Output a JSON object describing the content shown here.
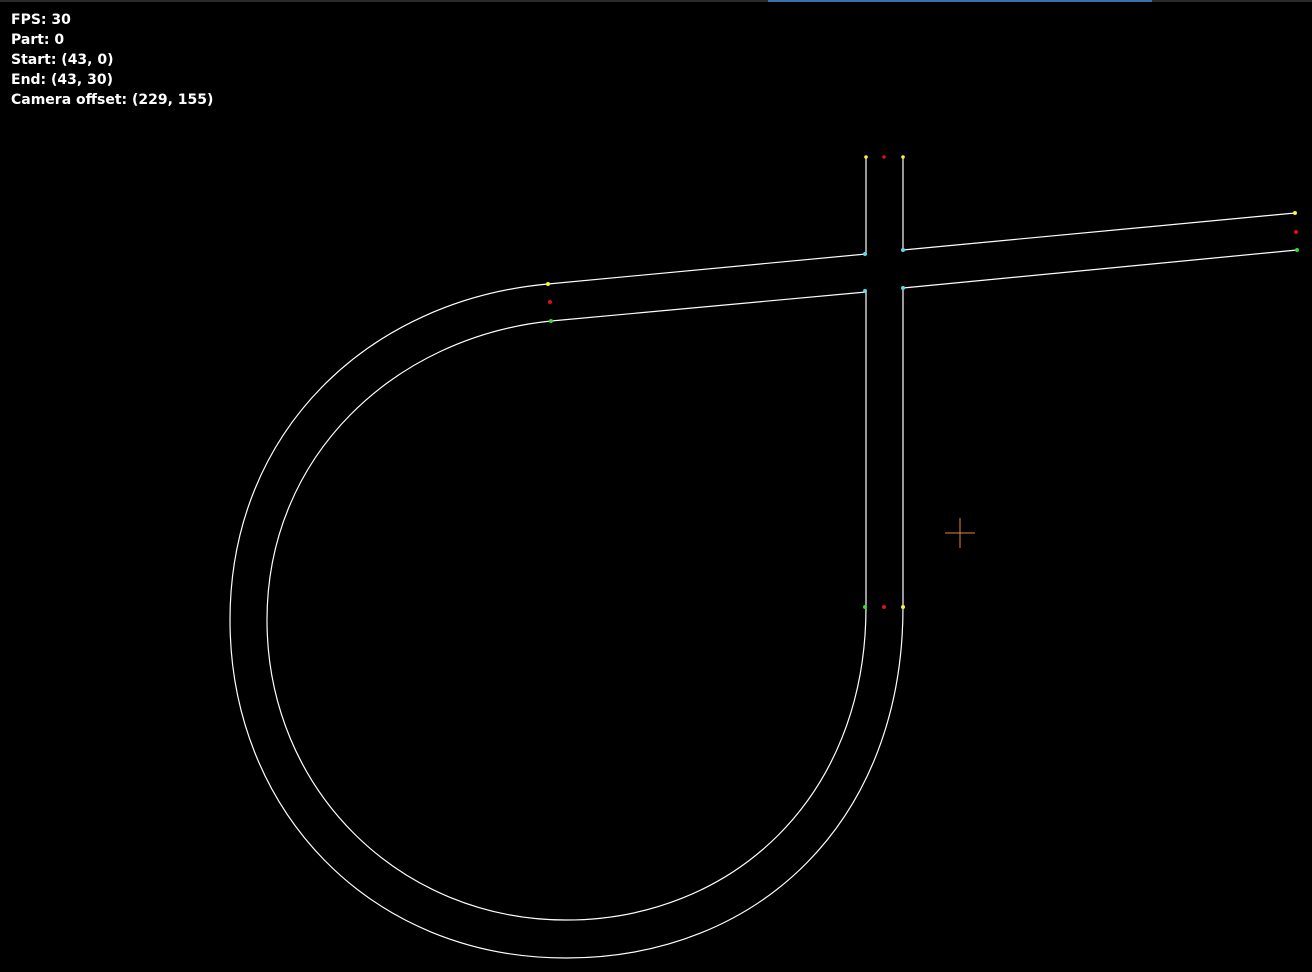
{
  "hud": {
    "fps_label": "FPS: 30",
    "part_label": "Part: 0",
    "start_label": "Start: (43, 0)",
    "end_label": "End: (43, 30)",
    "camera_label": "Camera offset: (229, 155)"
  },
  "colors": {
    "background": "#000000",
    "track": "#ffffff",
    "endpoint_yellow": "#ffee44",
    "endpoint_green": "#33dd33",
    "endpoint_center_red": "#dd1111",
    "junction_cyan": "#55ddee",
    "crosshair": "#dd8844"
  }
}
